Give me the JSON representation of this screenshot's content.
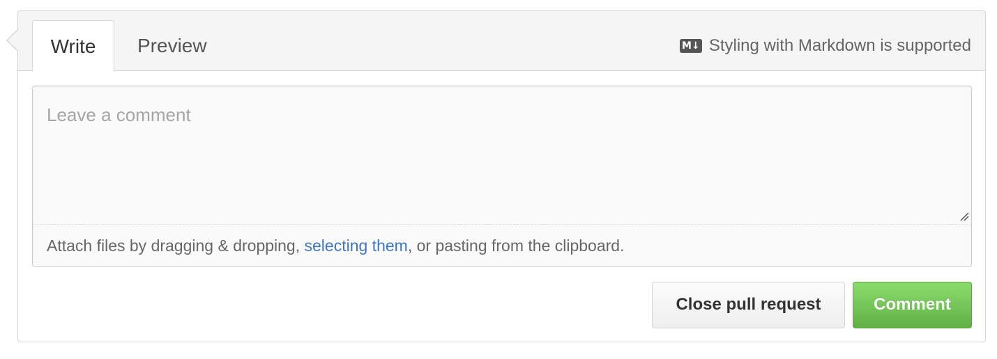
{
  "tabs": {
    "write_label": "Write",
    "preview_label": "Preview"
  },
  "markdown_hint": {
    "icon": "markdown-icon",
    "icon_text": "M↓",
    "text": "Styling with Markdown is supported"
  },
  "editor": {
    "placeholder": "Leave a comment",
    "value": ""
  },
  "attach": {
    "prefix": "Attach files by dragging & dropping, ",
    "link": "selecting them",
    "suffix": ", or pasting from the clipboard."
  },
  "actions": {
    "close_label": "Close pull request",
    "comment_label": "Comment"
  },
  "colors": {
    "accent_green": "#60b044",
    "link_blue": "#4078c0"
  }
}
